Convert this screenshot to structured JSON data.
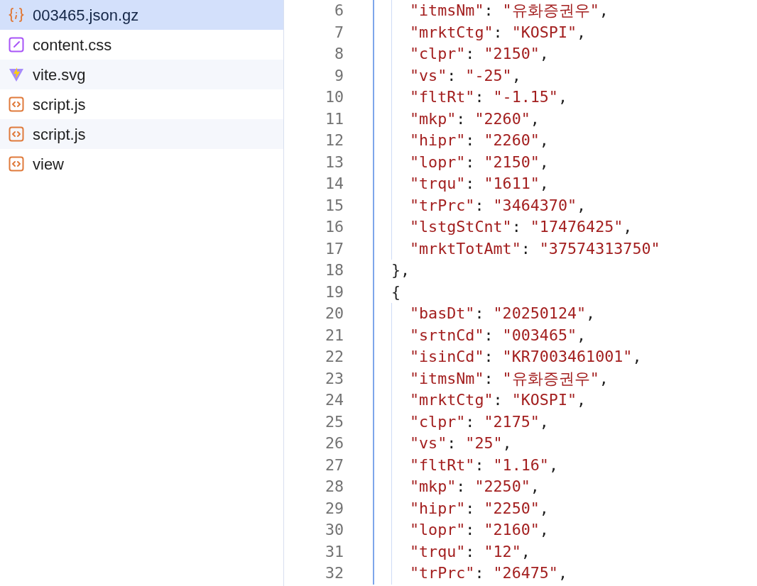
{
  "sidebar": {
    "files": [
      {
        "name": "003465.json.gz",
        "kind": "json",
        "selected": true
      },
      {
        "name": "content.css",
        "kind": "css",
        "selected": false
      },
      {
        "name": "vite.svg",
        "kind": "vite",
        "selected": false
      },
      {
        "name": "script.js",
        "kind": "code",
        "selected": false
      },
      {
        "name": "script.js",
        "kind": "code",
        "selected": false
      },
      {
        "name": "view",
        "kind": "code",
        "selected": false
      }
    ]
  },
  "editor": {
    "lines": [
      {
        "number": "6",
        "text": "    \"itmsNm\": \"유화증권우\","
      },
      {
        "number": "7",
        "text": "    \"mrktCtg\": \"KOSPI\","
      },
      {
        "number": "8",
        "text": "    \"clpr\": \"2150\","
      },
      {
        "number": "9",
        "text": "    \"vs\": \"-25\","
      },
      {
        "number": "10",
        "text": "    \"fltRt\": \"-1.15\","
      },
      {
        "number": "11",
        "text": "    \"mkp\": \"2260\","
      },
      {
        "number": "12",
        "text": "    \"hipr\": \"2260\","
      },
      {
        "number": "13",
        "text": "    \"lopr\": \"2150\","
      },
      {
        "number": "14",
        "text": "    \"trqu\": \"1611\","
      },
      {
        "number": "15",
        "text": "    \"trPrc\": \"3464370\","
      },
      {
        "number": "16",
        "text": "    \"lstgStCnt\": \"17476425\","
      },
      {
        "number": "17",
        "text": "    \"mrktTotAmt\": \"37574313750\""
      },
      {
        "number": "18",
        "text": "  },"
      },
      {
        "number": "19",
        "text": "  {"
      },
      {
        "number": "20",
        "text": "    \"basDt\": \"20250124\","
      },
      {
        "number": "21",
        "text": "    \"srtnCd\": \"003465\","
      },
      {
        "number": "22",
        "text": "    \"isinCd\": \"KR7003461001\","
      },
      {
        "number": "23",
        "text": "    \"itmsNm\": \"유화증권우\","
      },
      {
        "number": "24",
        "text": "    \"mrktCtg\": \"KOSPI\","
      },
      {
        "number": "25",
        "text": "    \"clpr\": \"2175\","
      },
      {
        "number": "26",
        "text": "    \"vs\": \"25\","
      },
      {
        "number": "27",
        "text": "    \"fltRt\": \"1.16\","
      },
      {
        "number": "28",
        "text": "    \"mkp\": \"2250\","
      },
      {
        "number": "29",
        "text": "    \"hipr\": \"2250\","
      },
      {
        "number": "30",
        "text": "    \"lopr\": \"2160\","
      },
      {
        "number": "31",
        "text": "    \"trqu\": \"12\","
      },
      {
        "number": "32",
        "text": "    \"trPrc\": \"26475\","
      }
    ]
  }
}
